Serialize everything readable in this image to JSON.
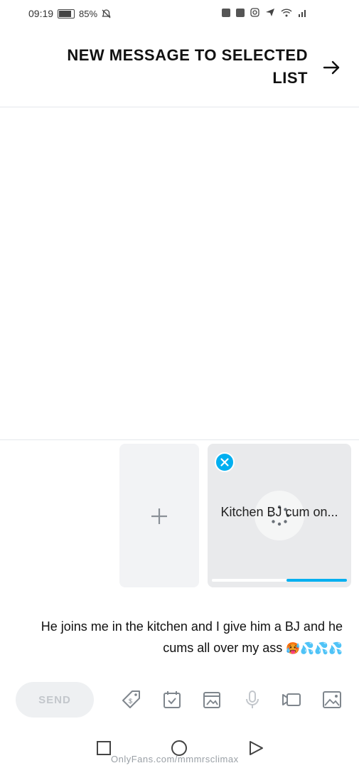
{
  "status_bar": {
    "time": "09:19",
    "battery": "85%",
    "icons": [
      "signal-icon",
      "wifi-icon",
      "messenger-icon",
      "instagram-icon",
      "gallery-icon",
      "facebook-icon",
      "mute-icon",
      "battery-icon"
    ]
  },
  "header": {
    "title": "NEW MESSAGE TO SELECTED LIST",
    "back_icon": "arrow-icon"
  },
  "attachments": {
    "add_icon": "plus-icon",
    "items": [
      {
        "name": "Kitchen BJ cum on...",
        "upload_progress": 0.45,
        "remove_icon": "close-icon",
        "loading_icon": "spinner-icon"
      }
    ]
  },
  "message": {
    "text": "He joins me in the kitchen and I give him a BJ and he cums all over my ass",
    "emojis": "🥵💦💦💦"
  },
  "toolbar": {
    "send_label": "SEND",
    "tools": [
      "image-icon",
      "video-icon",
      "microphone-icon",
      "vault-icon",
      "schedule-icon",
      "price-tag-icon"
    ]
  },
  "nav_bar": {
    "buttons": [
      "back-icon",
      "home-icon",
      "recents-icon"
    ],
    "watermark": "OnlyFans.com/mmmrsclimax"
  },
  "colors": {
    "accent": "#00aff0",
    "divider": "#e5e8ec",
    "tile_bg": "#e9eaec",
    "send_disabled_bg": "#eef0f2",
    "send_disabled_text": "#c3c7cc"
  }
}
